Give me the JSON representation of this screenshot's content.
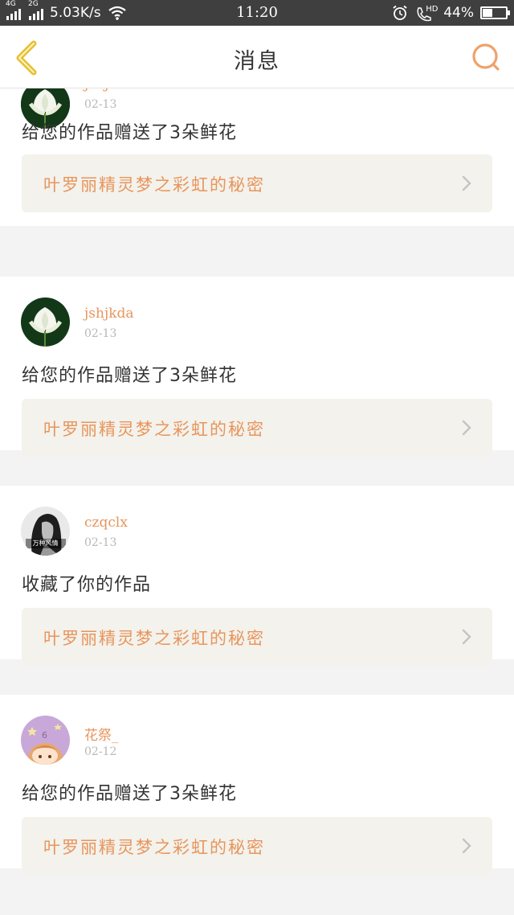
{
  "status_bar": {
    "net1": "4G",
    "net2": "2G",
    "speed": "5.03K/s",
    "time": "11:20",
    "hd": "HD",
    "battery_text": "44%",
    "battery_level": 0.44
  },
  "header": {
    "title": "消息",
    "back_icon": "chevron-left-icon",
    "search_icon": "search-icon"
  },
  "notifications": [
    {
      "username": "jshjkda",
      "date": "02-13",
      "message": "给您的作品赠送了3朵鲜花",
      "work_title": "叶罗丽精灵梦之彩虹的秘密"
    },
    {
      "username": "jshjkda",
      "date": "02-13",
      "message": "给您的作品赠送了3朵鲜花",
      "work_title": "叶罗丽精灵梦之彩虹的秘密"
    },
    {
      "username": "czqclx",
      "date": "02-13",
      "message": "收藏了你的作品",
      "work_title": "叶罗丽精灵梦之彩虹的秘密",
      "avatar_caption": "万种风情"
    },
    {
      "username": "花祭_",
      "date": "02-12",
      "message": "给您的作品赠送了3朵鲜花",
      "work_title": "叶罗丽精灵梦之彩虹的秘密"
    }
  ],
  "colors": {
    "accent": "#e8955c",
    "back_chevron": "#e6c034",
    "card_bg": "#ffffff",
    "work_bg": "#f3f2ec"
  }
}
